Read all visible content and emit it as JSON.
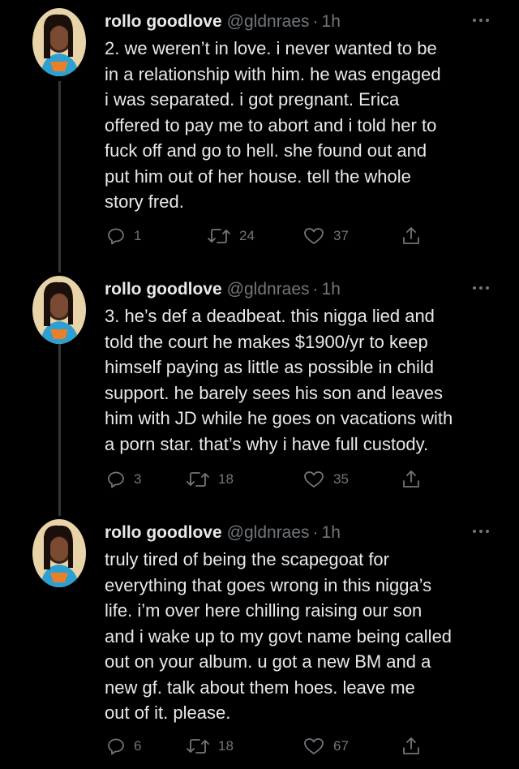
{
  "tweets": [
    {
      "name": "rollo goodlove",
      "handle": "@gldnraes",
      "separator": "·",
      "time": "1h",
      "text": "2. we weren’t in love.  i never wanted to be\nin a relationship with him.  he was engaged\ni was separated.  i got pregnant.  Erica\noffered to pay me to abort and i told her to\nfuck off and go to hell.  she found out and\nput him out of her house.  tell the whole\nstory fred.",
      "replies": "1",
      "retweets": "24",
      "likes": "37"
    },
    {
      "name": "rollo goodlove",
      "handle": "@gldnraes",
      "separator": "·",
      "time": "1h",
      "text": "3. he’s def a deadbeat.  this nigga lied and\ntold the court he makes $1900/yr to keep\nhimself paying as little as possible in child\nsupport.  he barely sees his son and leaves\nhim with JD while he goes on vacations with\na porn star.  that’s why i have full custody.",
      "replies": "3",
      "retweets": "18",
      "likes": "35"
    },
    {
      "name": "rollo goodlove",
      "handle": "@gldnraes",
      "separator": "·",
      "time": "1h",
      "text": "truly tired of being the scapegoat for\neverything that goes wrong in this nigga’s\nlife.  i’m over here chilling raising our son\nand i wake up to my govt name being called\nout on your album.  u got a new BM and a\nnew gf.  talk about them hoes.  leave me\nout of it.  please.",
      "replies": "6",
      "retweets": "18",
      "likes": "67"
    }
  ],
  "icons": {
    "reply": "reply-icon",
    "retweet": "retweet-icon",
    "like": "heart-icon",
    "share": "share-icon",
    "more": "more-icon"
  },
  "colors": {
    "background": "#000000",
    "text": "#e7e9ea",
    "muted": "#71767b",
    "thread_line": "#333639"
  }
}
